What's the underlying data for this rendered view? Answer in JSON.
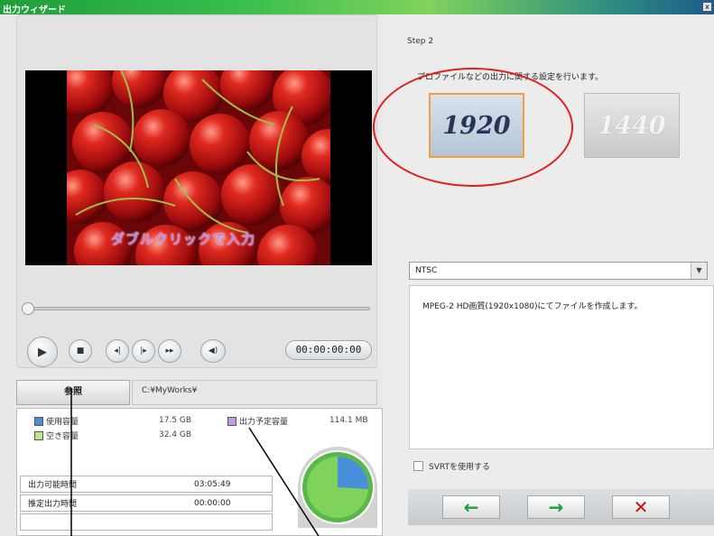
{
  "window": {
    "title": "出力ウィザード",
    "close_label": "x"
  },
  "step": {
    "label": "Step 2",
    "description": "プロファイルなどの出力に関する設定を行います。"
  },
  "preview": {
    "overlay_text": "ダブルクリックで入力"
  },
  "playback": {
    "timecode": "00:00:00:00"
  },
  "output": {
    "browse_label": "参照",
    "path": "C:¥MyWorks¥"
  },
  "disk": {
    "items": [
      {
        "label": "使用容量",
        "value": "17.5 GB",
        "color": "#4a90d9"
      },
      {
        "label": "空き容量",
        "value": "32.4 GB",
        "color": "#b9e88a"
      },
      {
        "label": "出力予定容量",
        "value": "114.1 MB",
        "color": "#c59be6"
      }
    ]
  },
  "times": [
    {
      "label": "出力可能時間",
      "value": "03:05:49"
    },
    {
      "label": "推定出力時間",
      "value": "00:00:00"
    }
  ],
  "profiles": [
    {
      "label": "1920",
      "selected": true
    },
    {
      "label": "1440",
      "selected": false
    }
  ],
  "format": {
    "selected": "NTSC"
  },
  "info_text": "MPEG-2 HD画質(1920x1080)にてファイルを作成します。",
  "svrt_label": "SVRTを使用する",
  "nav": {
    "back": "←",
    "next": "→",
    "cancel": "✕"
  },
  "colors": {
    "back_arrow": "#18a23a",
    "next_arrow": "#18a23a",
    "cancel": "#d01010",
    "circle": "#e02020"
  }
}
